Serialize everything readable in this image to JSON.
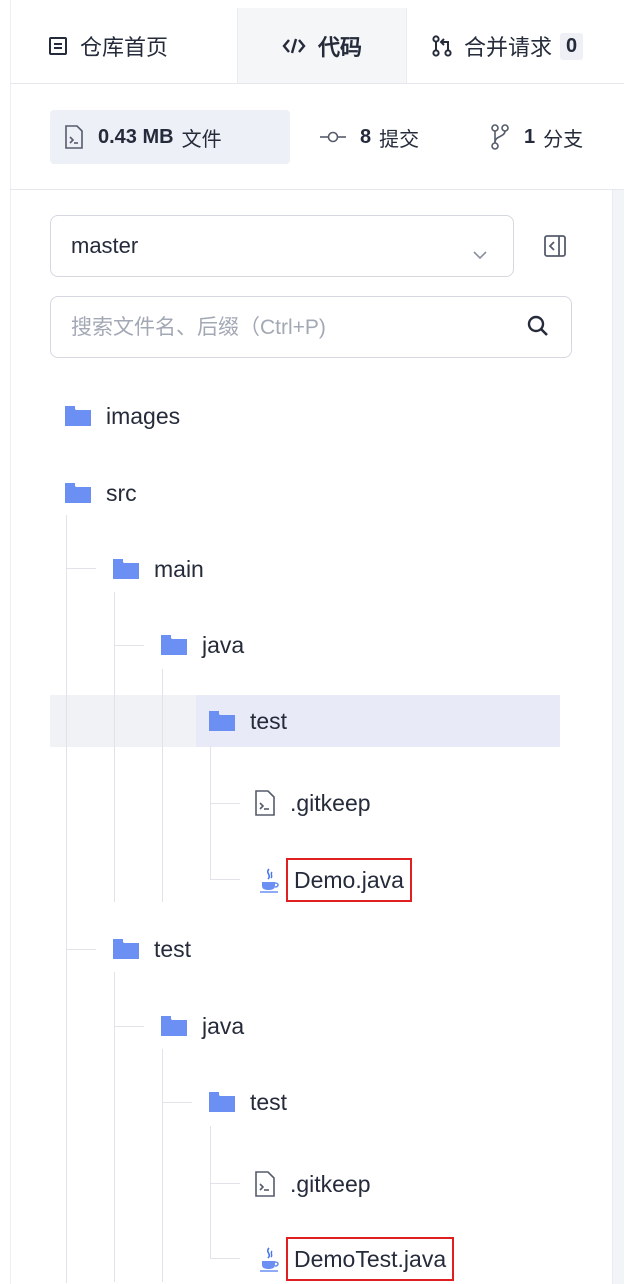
{
  "tabs": {
    "home": "仓库首页",
    "code": "代码",
    "merge_requests": "合并请求",
    "merge_requests_count": "0"
  },
  "stats": {
    "size_value": "0.43 MB",
    "size_label": "文件",
    "commits_value": "8",
    "commits_label": "提交",
    "branches_value": "1",
    "branches_label": "分支"
  },
  "branch_selector": {
    "value": "master"
  },
  "search": {
    "placeholder": "搜索文件名、后缀（Ctrl+P)"
  },
  "tree": [
    {
      "name": "images",
      "type": "folder"
    },
    {
      "name": "src",
      "type": "folder"
    },
    {
      "name": "main",
      "type": "folder"
    },
    {
      "name": "java",
      "type": "folder"
    },
    {
      "name": "test",
      "type": "folder",
      "selected": true
    },
    {
      "name": ".gitkeep",
      "type": "file"
    },
    {
      "name": "Demo.java",
      "type": "java",
      "annotated": true
    },
    {
      "name": "test",
      "type": "folder"
    },
    {
      "name": "java",
      "type": "folder"
    },
    {
      "name": "test",
      "type": "folder"
    },
    {
      "name": ".gitkeep",
      "type": "file"
    },
    {
      "name": "DemoTest.java",
      "type": "java",
      "annotated": true
    }
  ],
  "colors": {
    "folder": "#6b8ff2",
    "selected_row": "#e8ebf7",
    "annotation": "#e02020",
    "text": "#252b3a"
  },
  "icons": {
    "home_tab": "repo-home-icon",
    "code_tab": "code-icon",
    "merge_tab": "merge-request-icon",
    "size": "file-icon",
    "commits": "commit-icon",
    "branches": "branch-icon",
    "collapse": "panel-collapse-icon",
    "search": "search-icon",
    "folder": "folder-icon",
    "file": "file-icon",
    "java": "java-icon"
  }
}
